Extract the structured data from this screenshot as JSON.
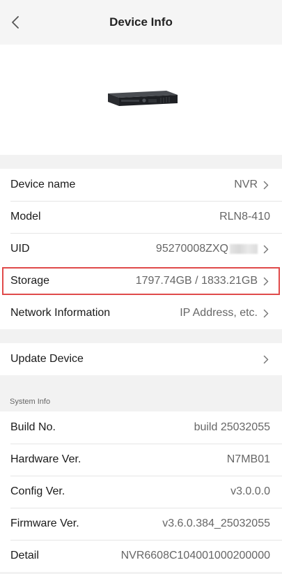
{
  "header": {
    "title": "Device Info"
  },
  "device_rows": [
    {
      "label": "Device name",
      "value": "NVR"
    },
    {
      "label": "Model",
      "value": "RLN8-410"
    },
    {
      "label": "UID",
      "value": "95270008ZXQ"
    },
    {
      "label": "Storage",
      "value": "1797.74GB / 1833.21GB"
    },
    {
      "label": "Network Information",
      "value": "IP Address, etc."
    }
  ],
  "update": {
    "label": "Update Device"
  },
  "system_info": {
    "title": "System Info",
    "rows": [
      {
        "label": "Build No.",
        "value": "build 25032055"
      },
      {
        "label": "Hardware Ver.",
        "value": "N7MB01"
      },
      {
        "label": "Config Ver.",
        "value": "v3.0.0.0"
      },
      {
        "label": "Firmware Ver.",
        "value": "v3.6.0.384_25032055"
      },
      {
        "label": "Detail",
        "value": "NVR6608C104001000200000"
      }
    ]
  },
  "colors": {
    "highlight": "#e04a4a",
    "background": "#f2f2f2"
  },
  "icons": {
    "back": "chevron-left-icon",
    "row_arrow": "chevron-right-icon"
  }
}
